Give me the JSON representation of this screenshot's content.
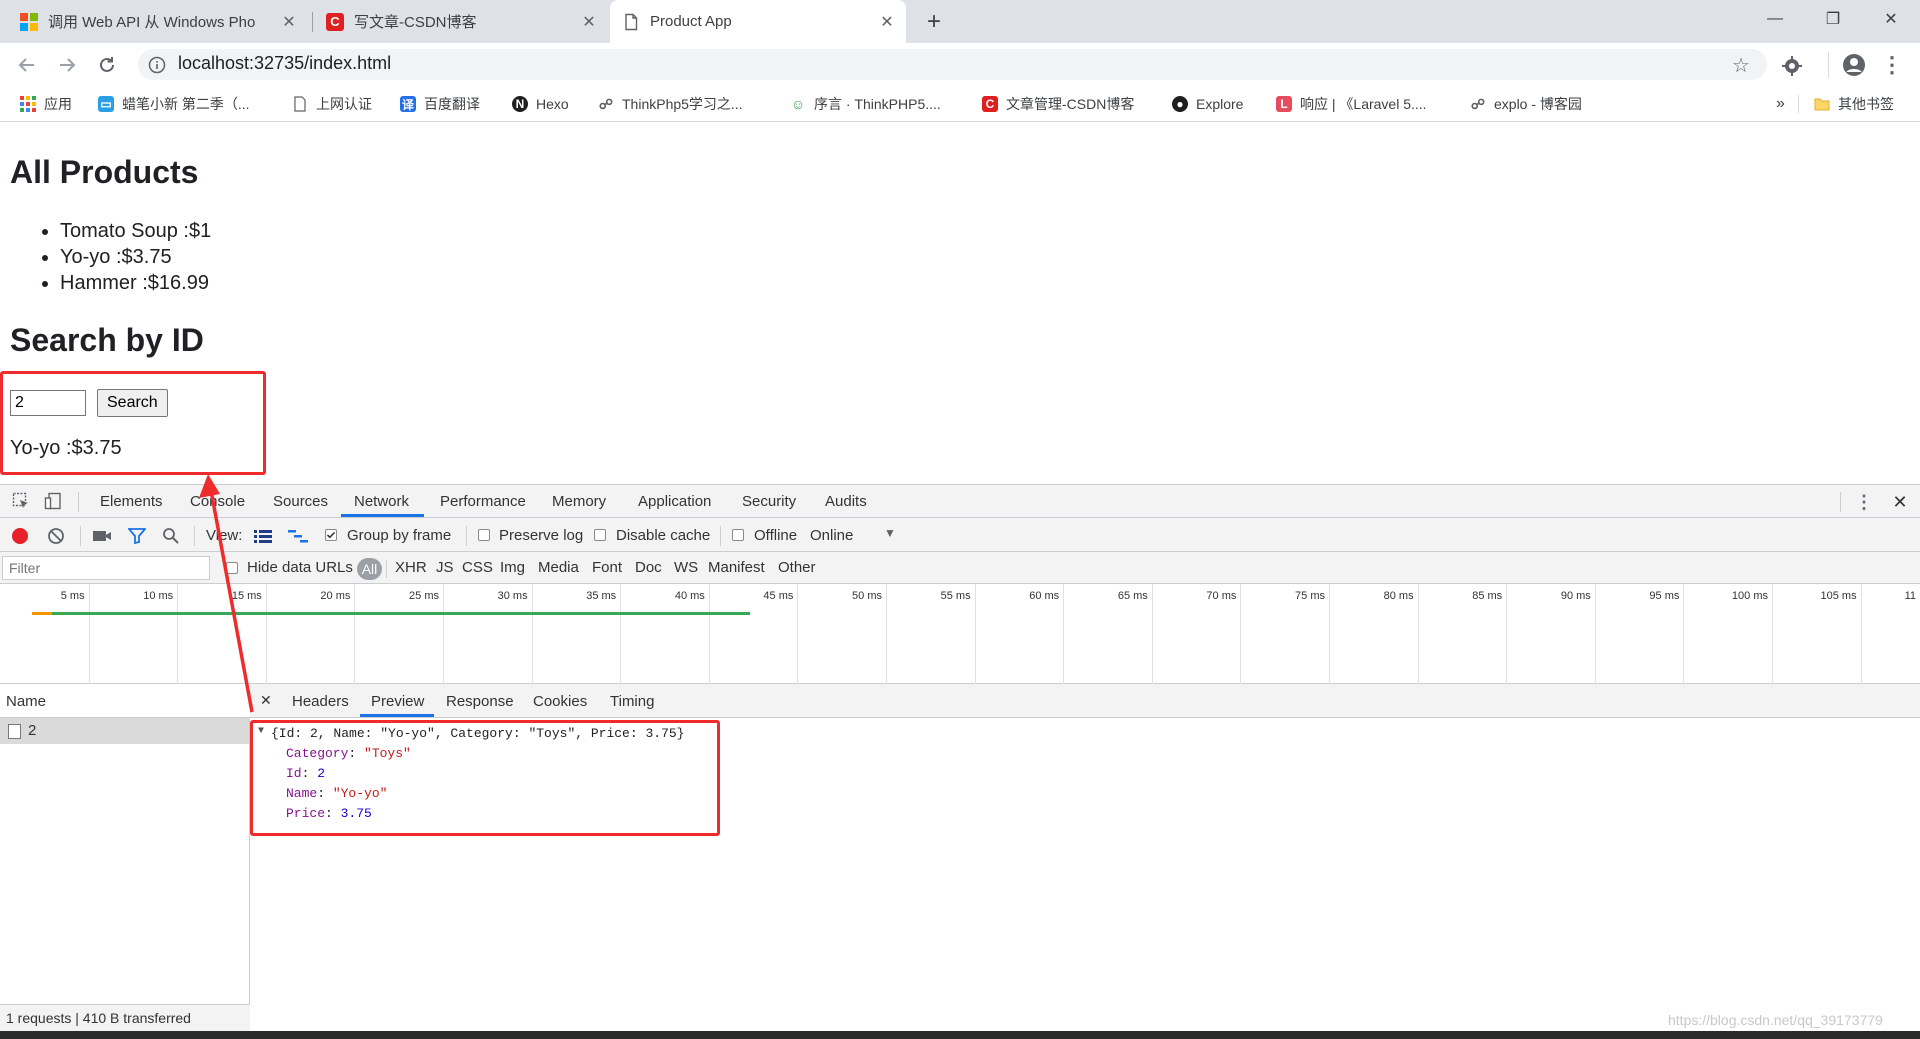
{
  "browser": {
    "tabs": [
      {
        "title": "调用 Web API 从 Windows Pho",
        "close": "✕",
        "active": false
      },
      {
        "title": "写文章-CSDN博客",
        "close": "✕",
        "active": false
      },
      {
        "title": "Product App",
        "close": "✕",
        "active": true
      }
    ],
    "new_tab": "+",
    "window_controls": {
      "minimize": "—",
      "maximize": "❐",
      "close": "✕"
    },
    "url": "localhost:32735/index.html",
    "bookmarks": [
      {
        "label": "应用",
        "icon": "apps-icon"
      },
      {
        "label": "蜡笔小新 第二季（...",
        "icon": "tv-icon"
      },
      {
        "label": "上网认证",
        "icon": "page-icon"
      },
      {
        "label": "百度翻译",
        "icon": "translate-icon"
      },
      {
        "label": "Hexo",
        "icon": "hexo-icon"
      },
      {
        "label": "ThinkPhp5学习之...",
        "icon": "bookmark-icon"
      },
      {
        "label": "序言 · ThinkPHP5....",
        "icon": "bookmark-icon"
      },
      {
        "label": "文章管理-CSDN博客",
        "icon": "csdn-icon"
      },
      {
        "label": "Explore",
        "icon": "github-icon"
      },
      {
        "label": "响应 | 《Laravel 5....",
        "icon": "laravel-icon"
      },
      {
        "label": "explo - 博客园",
        "icon": "bookmark-icon"
      }
    ],
    "bookmarks_overflow": "»",
    "other_bookmarks": "其他书签"
  },
  "page": {
    "heading": "All Products",
    "products": [
      "Tomato Soup :$1",
      "Yo-yo :$3.75",
      "Hammer :$16.99"
    ],
    "search_heading": "Search by ID",
    "search_value": "2",
    "search_button": "Search",
    "result": "Yo-yo :$3.75"
  },
  "devtools": {
    "tabs": [
      "Elements",
      "Console",
      "Sources",
      "Network",
      "Performance",
      "Memory",
      "Application",
      "Security",
      "Audits"
    ],
    "active_tab": "Network",
    "toolbar": {
      "view_label": "View:",
      "group_by_frame": "Group by frame",
      "preserve_log": "Preserve log",
      "disable_cache": "Disable cache",
      "offline": "Offline",
      "throttle": "Online"
    },
    "filter": {
      "placeholder": "Filter",
      "hide_data_urls": "Hide data URLs",
      "types": [
        "All",
        "XHR",
        "JS",
        "CSS",
        "Img",
        "Media",
        "Font",
        "Doc",
        "WS",
        "Manifest",
        "Other"
      ]
    },
    "timeline_ticks": [
      "5 ms",
      "10 ms",
      "15 ms",
      "20 ms",
      "25 ms",
      "30 ms",
      "35 ms",
      "40 ms",
      "45 ms",
      "50 ms",
      "55 ms",
      "60 ms",
      "65 ms",
      "70 ms",
      "75 ms",
      "80 ms",
      "85 ms",
      "90 ms",
      "95 ms",
      "100 ms",
      "105 ms",
      "11"
    ],
    "name_header": "Name",
    "request_name": "2",
    "status": "1 requests  |  410 B transferred",
    "detail_tabs": [
      "Headers",
      "Preview",
      "Response",
      "Cookies",
      "Timing"
    ],
    "detail_active": "Preview",
    "preview": {
      "summary": "{Id: 2, Name: \"Yo-yo\", Category: \"Toys\", Price: 3.75}",
      "fields": [
        {
          "key": "Category",
          "value": "\"Toys\"",
          "kind": "str"
        },
        {
          "key": "Id",
          "value": "2",
          "kind": "num"
        },
        {
          "key": "Name",
          "value": "\"Yo-yo\"",
          "kind": "str"
        },
        {
          "key": "Price",
          "value": "3.75",
          "kind": "num"
        }
      ]
    }
  },
  "watermark": "https://blog.csdn.net/qq_39173779",
  "colors": {
    "annotation_red": "#ef2b2b",
    "devtools_blue": "#1a73e8",
    "record_red": "#e8202a"
  }
}
